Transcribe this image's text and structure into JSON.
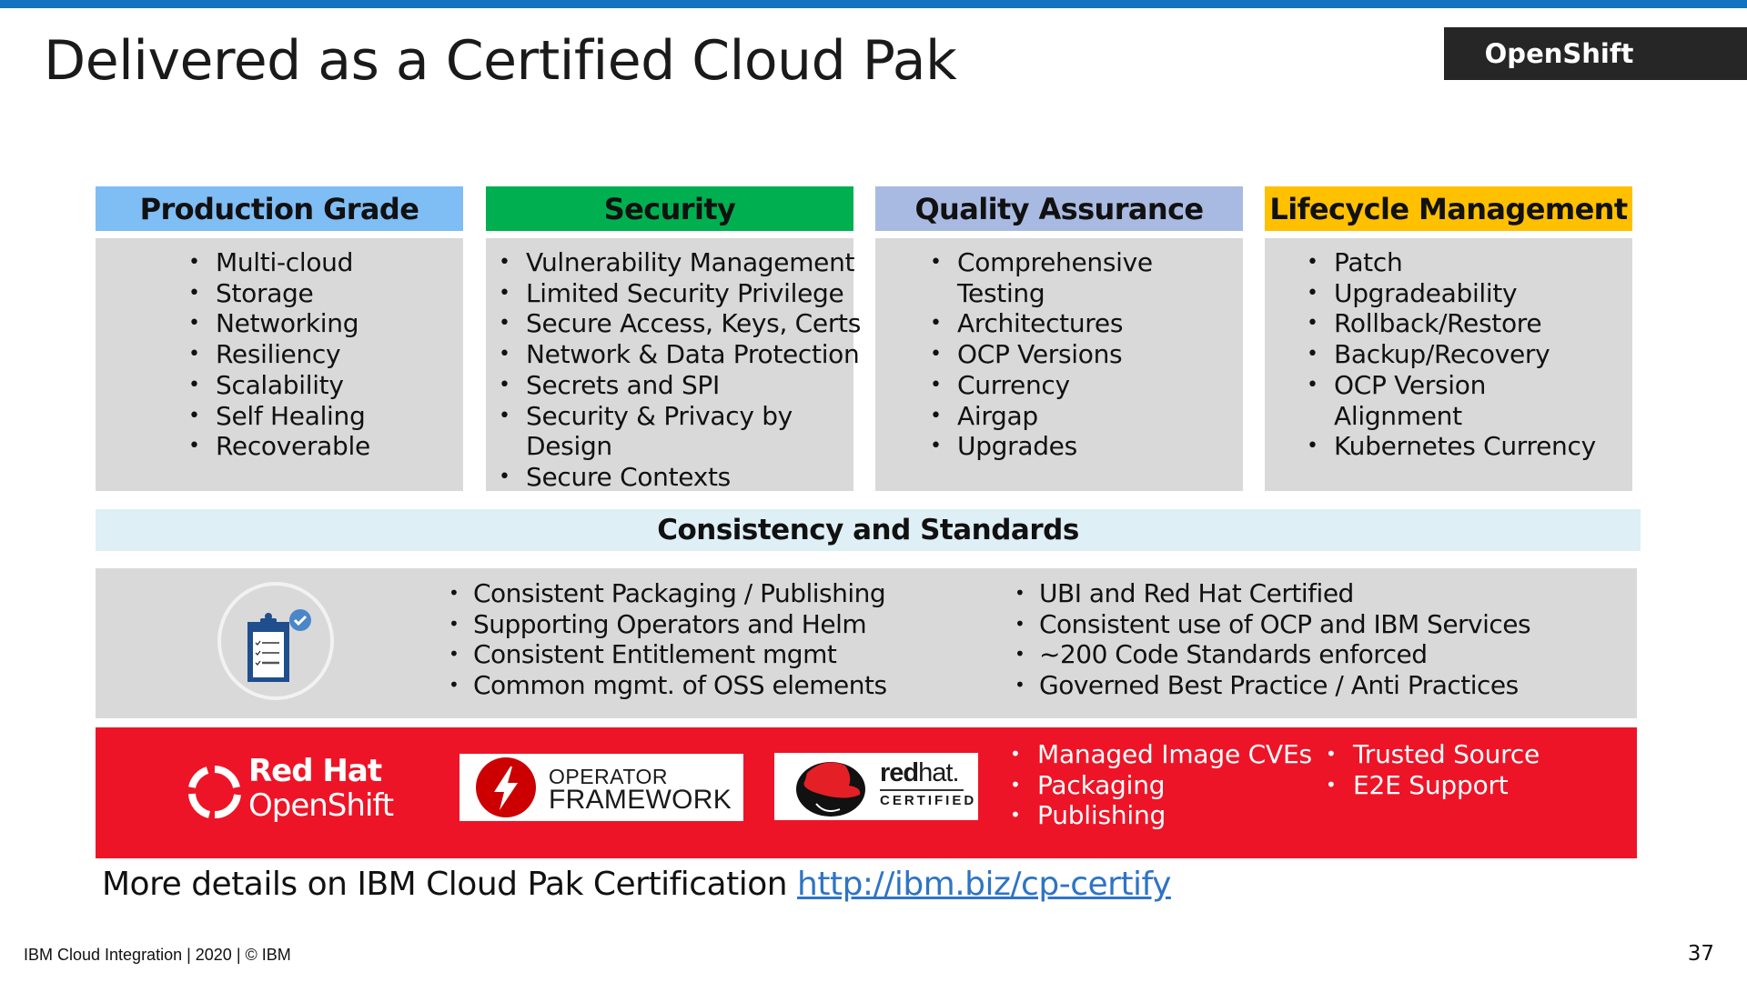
{
  "slide": {
    "title": "Delivered as a Certified Cloud Pak",
    "badge": "OpenShift",
    "accent_color": "#1172c2"
  },
  "columns": [
    {
      "title": "Production Grade",
      "color": "#7fbdf5",
      "items": [
        [
          "Multi-cloud"
        ],
        [
          "Storage"
        ],
        [
          "Networking"
        ],
        [
          "Resiliency"
        ],
        [
          "Scalability"
        ],
        [
          "Self Healing"
        ],
        [
          "Recoverable"
        ]
      ]
    },
    {
      "title": "Security",
      "color": "#00b050",
      "items": [
        [
          "Vulnerability Management"
        ],
        [
          "Limited Security Privilege"
        ],
        [
          "Secure Access, Keys, Certs"
        ],
        [
          "Network & Data Protection"
        ],
        [
          "Secrets and SPI"
        ],
        [
          "Security & Privacy by",
          "Design"
        ],
        [
          "Secure Contexts"
        ]
      ]
    },
    {
      "title": "Quality Assurance",
      "color": "#a9bae2",
      "items": [
        [
          "Comprehensive",
          "Testing"
        ],
        [
          "Architectures"
        ],
        [
          "OCP Versions"
        ],
        [
          "Currency"
        ],
        [
          "Airgap"
        ],
        [
          "Upgrades"
        ]
      ]
    },
    {
      "title": "Lifecycle Management",
      "color": "#ffc000",
      "items": [
        [
          "Patch"
        ],
        [
          "Upgradeability"
        ],
        [
          "Rollback/Restore"
        ],
        [
          "Backup/Recovery"
        ],
        [
          "OCP Version",
          "Alignment"
        ],
        [
          "Kubernetes Currency"
        ]
      ]
    }
  ],
  "consistency": {
    "title": "Consistency and Standards",
    "icon": "clipboard-checklist-icon",
    "left_items": [
      "Consistent Packaging / Publishing",
      "Supporting Operators and Helm",
      "Consistent Entitlement mgmt",
      "Common mgmt. of OSS elements"
    ],
    "right_items": [
      "UBI and Red Hat Certified",
      "Consistent use of OCP and IBM Services",
      "~200 Code Standards enforced",
      "Governed Best Practice / Anti Practices"
    ]
  },
  "certification": {
    "color": "#ee1427",
    "logos": {
      "openshift": {
        "line1": "Red Hat",
        "line2": "OpenShift"
      },
      "operator_framework": {
        "line1": "OPERATOR",
        "line2": "FRAMEWORK"
      },
      "redhat_certified": {
        "bold": "red",
        "light": "hat.",
        "sub": "CERTIFIED"
      }
    },
    "left_items": [
      "Managed Image CVEs",
      "Packaging",
      "Publishing"
    ],
    "right_items": [
      "Trusted Source",
      "E2E Support"
    ]
  },
  "more": {
    "text": "More details on IBM Cloud Pak Certification ",
    "link_text": "http://ibm.biz/cp-certify"
  },
  "footer": {
    "text": "IBM Cloud Integration  | 2020 | © IBM",
    "page_number": "37"
  }
}
